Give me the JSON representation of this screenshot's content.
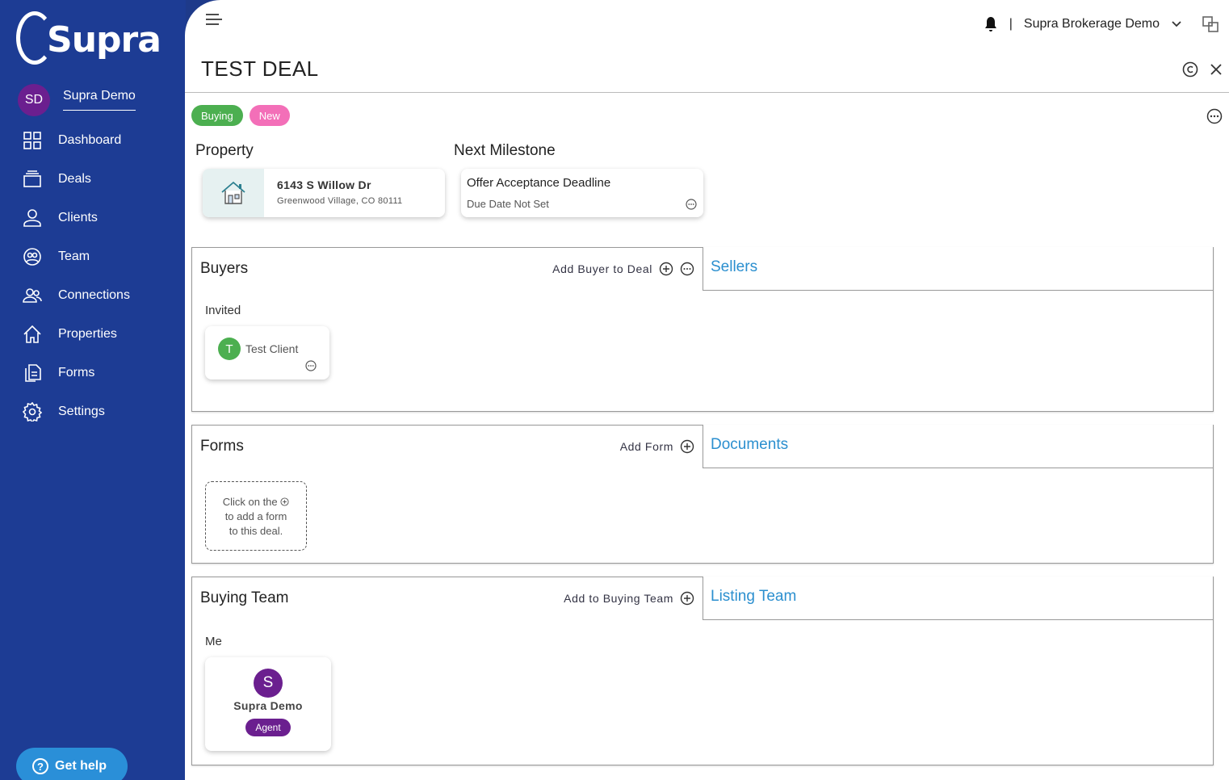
{
  "sidebar": {
    "logo_text": "Supra",
    "user": {
      "initials": "SD",
      "name": "Supra Demo"
    },
    "items": [
      {
        "label": "Dashboard",
        "icon": "dashboard-icon"
      },
      {
        "label": "Deals",
        "icon": "deals-icon"
      },
      {
        "label": "Clients",
        "icon": "clients-icon"
      },
      {
        "label": "Team",
        "icon": "team-icon"
      },
      {
        "label": "Connections",
        "icon": "connections-icon"
      },
      {
        "label": "Properties",
        "icon": "properties-icon"
      },
      {
        "label": "Forms",
        "icon": "forms-icon"
      },
      {
        "label": "Settings",
        "icon": "settings-icon"
      }
    ],
    "help_label": "Get help"
  },
  "topbar": {
    "separator": "|",
    "org": "Supra Brokerage Demo"
  },
  "deal": {
    "title": "TEST DEAL",
    "badges": {
      "buying": "Buying",
      "new": "New"
    }
  },
  "property": {
    "section_label": "Property",
    "address": "6143 S Willow Dr",
    "city": "Greenwood Village,  CO  80111"
  },
  "milestone": {
    "section_label": "Next Milestone",
    "name": "Offer Acceptance Deadline",
    "due": "Due Date Not Set"
  },
  "buyers": {
    "tab_active": "Buyers",
    "add_label": "Add Buyer to Deal",
    "tab_inactive": "Sellers",
    "sub_label": "Invited",
    "client": {
      "initial": "T",
      "name": "Test Client"
    }
  },
  "forms": {
    "tab_active": "Forms",
    "add_label": "Add Form",
    "tab_inactive": "Documents",
    "hint_line1": "Click on the",
    "hint_line2": "to add a form",
    "hint_line3": "to this deal."
  },
  "team": {
    "tab_active": "Buying Team",
    "add_label": "Add to Buying Team",
    "tab_inactive": "Listing Team",
    "sub_label": "Me",
    "member": {
      "initial": "S",
      "name": "Supra Demo",
      "role": "Agent"
    }
  },
  "colors": {
    "sidebar": "#1d3c94",
    "accent": "#2b8fcf",
    "buying": "#4caf50",
    "new": "#f36fb8",
    "avatar_purple": "#6b1f8f"
  }
}
